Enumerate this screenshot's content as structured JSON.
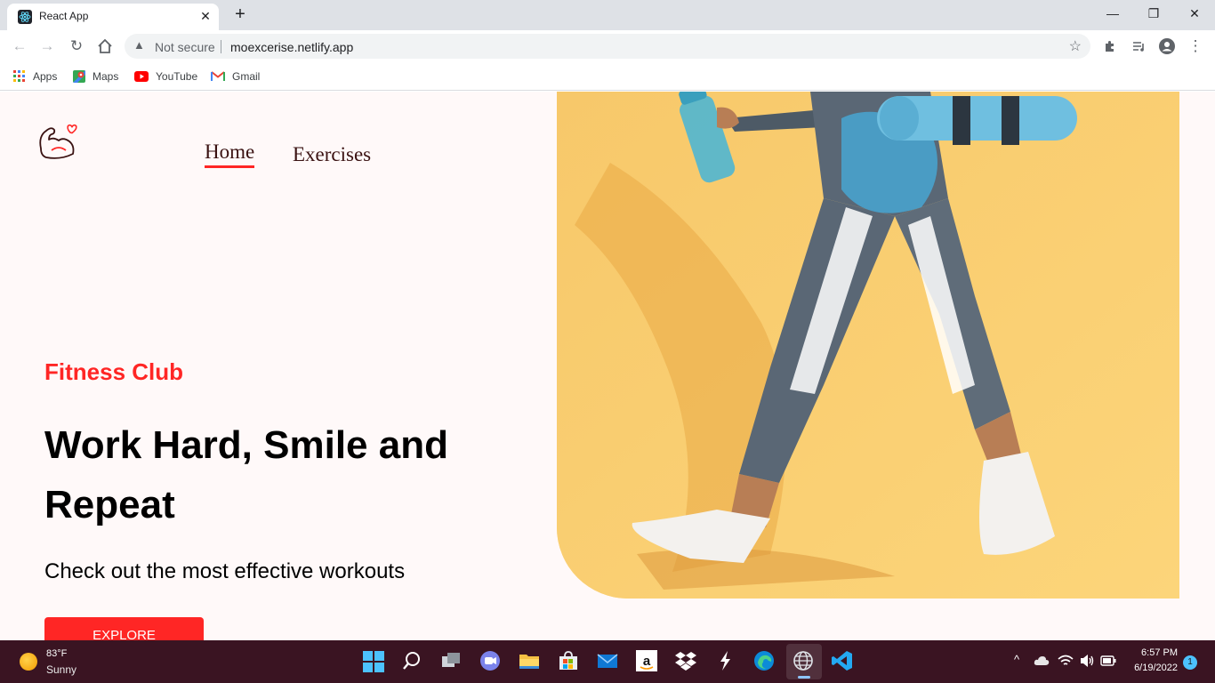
{
  "browser": {
    "tab_title": "React App",
    "tab_close": "✕",
    "new_tab": "+",
    "window_controls": {
      "minimize": "—",
      "restore": "❐",
      "close": "✕"
    },
    "security_label": "Not secure",
    "url": "moexcerise.netlify.app",
    "bookmarks": [
      {
        "label": "Apps",
        "icon": "apps-grid-icon"
      },
      {
        "label": "Maps",
        "icon": "maps-icon"
      },
      {
        "label": "YouTube",
        "icon": "youtube-icon"
      },
      {
        "label": "Gmail",
        "icon": "gmail-icon"
      }
    ]
  },
  "site": {
    "nav": {
      "home": "Home",
      "exercises": "Exercises"
    },
    "hero": {
      "kicker": "Fitness Club",
      "title": "Work Hard, Smile and Repeat",
      "subtitle": "Check out the most effective workouts",
      "cta": "EXPLORE WORKOUTS"
    },
    "colors": {
      "accent": "#ff2625",
      "page_bg": "#fff9f9",
      "hero_bg": "#fbcf69"
    }
  },
  "taskbar": {
    "weather_temp": "83°F",
    "weather_condition": "Sunny",
    "time": "6:57 PM",
    "date": "6/19/2022",
    "notification_count": "1"
  }
}
